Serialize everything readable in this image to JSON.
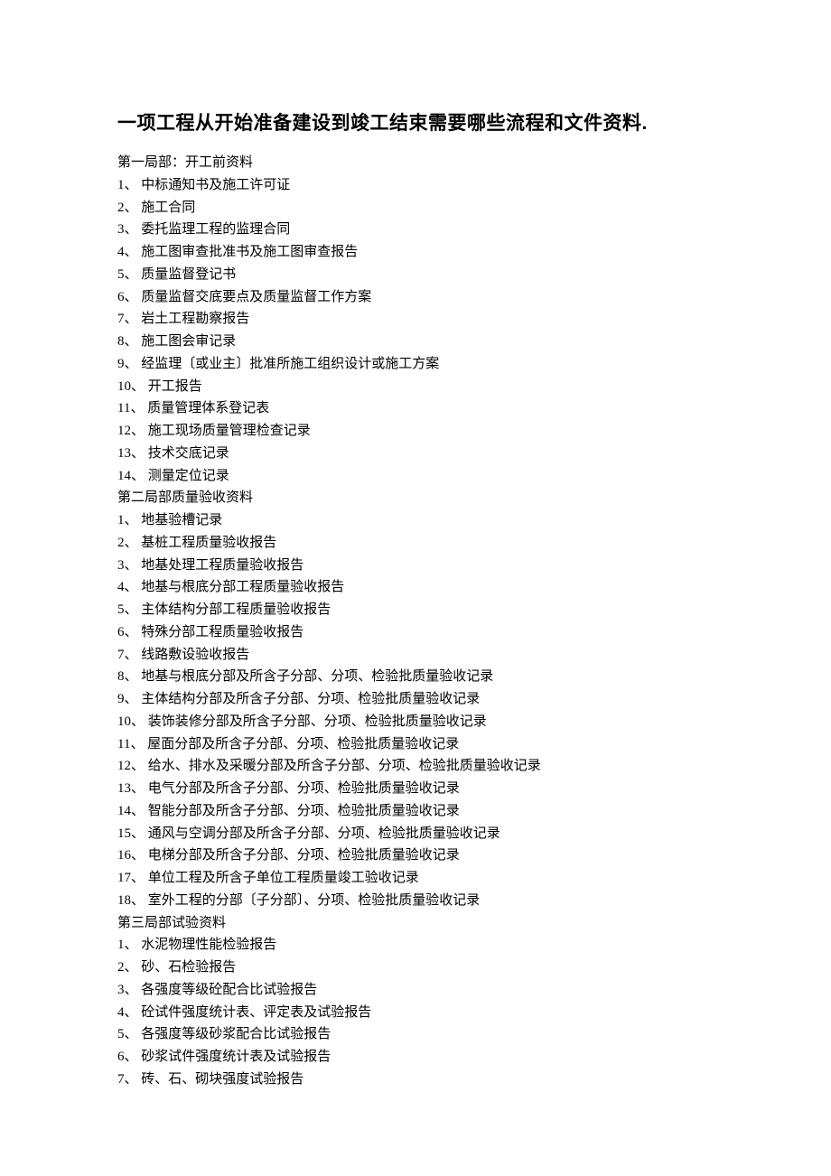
{
  "title": "一项工程从开始准备建设到竣工结束需要哪些流程和文件资料.",
  "sections": [
    {
      "header": "第一局部：开工前资料",
      "items": [
        "中标通知书及施工许可证",
        "施工合同",
        "委托监理工程的监理合同",
        "施工图审查批准书及施工图审查报告",
        "质量监督登记书",
        "质量监督交底要点及质量监督工作方案",
        "岩土工程勘察报告",
        "施工图会审记录",
        "经监理〔或业主〕批准所施工组织设计或施工方案",
        "开工报告",
        "质量管理体系登记表",
        "施工现场质量管理检查记录",
        "技术交底记录",
        "测量定位记录"
      ]
    },
    {
      "header": "第二局部质量验收资料",
      "items": [
        "地基验槽记录",
        "基桩工程质量验收报告",
        "地基处理工程质量验收报告",
        "地基与根底分部工程质量验收报告",
        "主体结构分部工程质量验收报告",
        "特殊分部工程质量验收报告",
        "线路敷设验收报告",
        "地基与根底分部及所含子分部、分项、检验批质量验收记录",
        "主体结构分部及所含子分部、分项、检验批质量验收记录",
        "装饰装修分部及所含子分部、分项、检验批质量验收记录",
        "屋面分部及所含子分部、分项、检验批质量验收记录",
        "给水、排水及采暖分部及所含子分部、分项、检验批质量验收记录",
        "电气分部及所含子分部、分项、检验批质量验收记录",
        "智能分部及所含子分部、分项、检验批质量验收记录",
        "通风与空调分部及所含子分部、分项、检验批质量验收记录",
        "电梯分部及所含子分部、分项、检验批质量验收记录",
        "单位工程及所含子单位工程质量竣工验收记录",
        "室外工程的分部〔子分部〕、分项、检验批质量验收记录"
      ]
    },
    {
      "header": "第三局部试验资料",
      "items": [
        "水泥物理性能检验报告",
        "砂、石检验报告",
        "各强度等级砼配合比试验报告",
        "砼试件强度统计表、评定表及试验报告",
        "各强度等级砂浆配合比试验报告",
        "砂浆试件强度统计表及试验报告",
        "砖、石、砌块强度试验报告"
      ]
    }
  ]
}
